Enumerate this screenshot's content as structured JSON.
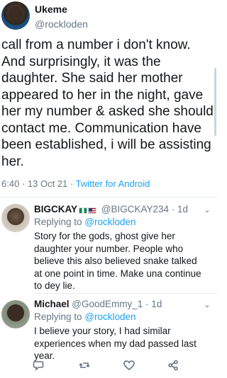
{
  "main_tweet": {
    "display_name": "Ukeme",
    "handle": "@rockloden",
    "text": "call from a number i don't know. And surprisingly, it was the daughter. She said her mother appeared to her in the night, gave her my number & asked she should contact me. Communication have been established, i will be assisting her.",
    "time": "6:40",
    "date": "13 Oct 21",
    "separator": "·",
    "source_app": "Twitter for Android"
  },
  "replies": [
    {
      "display_name": "BIGCKAY",
      "flags": [
        "flag-nigeria",
        "flag-usa"
      ],
      "handle": "@BIGCKAY234",
      "age": "· 1d",
      "replying_prefix": "Replying to",
      "replying_to": "@rockloden",
      "text": "Story for the gods, ghost give her daughter  your number. People who believe this also believed snake talked at one point in time. Make una continue to dey lie."
    },
    {
      "display_name": "Michael",
      "handle": "@GoodEmmy_1",
      "age": "· 1d",
      "replying_prefix": "Replying to",
      "replying_to": "@rockloden",
      "text": "I believe your story, I had similar experiences when my dad passed last year."
    }
  ],
  "actions": [
    "reply-icon",
    "retweet-icon",
    "like-icon",
    "share-icon"
  ],
  "colors": {
    "link": "#1da1f2",
    "muted": "#657786",
    "text": "#14171a",
    "divider": "#e6ecf0"
  }
}
